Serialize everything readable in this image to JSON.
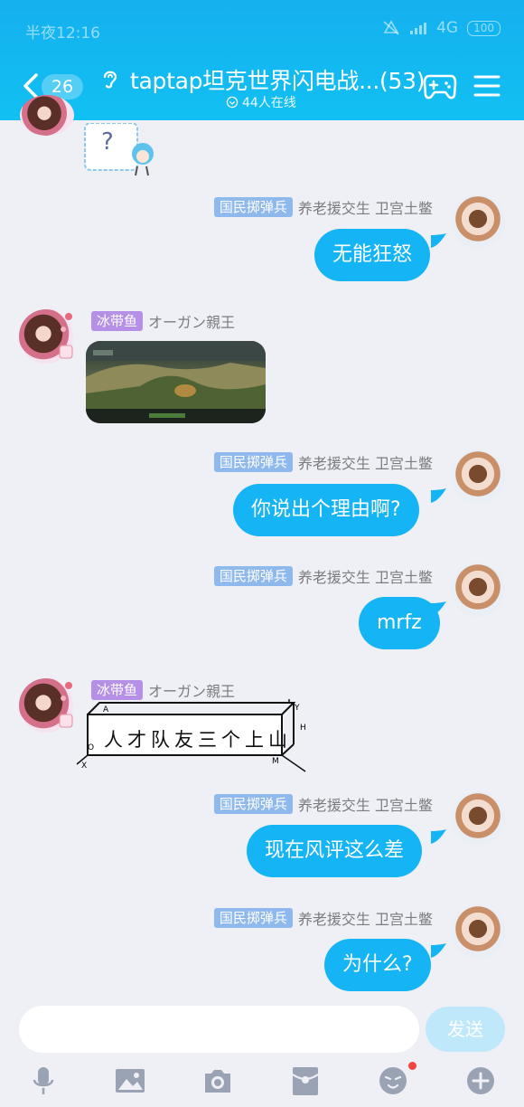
{
  "status_bar": {
    "time": "半夜12:16",
    "network": "4G",
    "battery": "100"
  },
  "header": {
    "unread_count": "26",
    "title": "taptap坦克世界闪电战...(53)",
    "online": "44人在线"
  },
  "messages": [
    {
      "side": "left",
      "type": "sticker",
      "content": "?"
    },
    {
      "side": "right",
      "tag": "国民掷弹兵",
      "sender": "养老援交生 卫宫土鳖",
      "text": "无能狂怒"
    },
    {
      "side": "left",
      "tag": "冰带鱼",
      "sender": "オーガン親王",
      "type": "image"
    },
    {
      "side": "right",
      "tag": "国民掷弹兵",
      "sender": "养老援交生 卫宫土鳖",
      "text": "你说出个理由啊?"
    },
    {
      "side": "right",
      "tag": "国民掷弹兵",
      "sender": "养老援交生 卫宫土鳖",
      "text": "mrfz"
    },
    {
      "side": "left",
      "tag": "冰带鱼",
      "sender": "オーガン親王",
      "type": "sticker",
      "sticker_text": "人才队友三个上山",
      "axis_labels": {
        "a": "A",
        "y": "Y",
        "h": "H",
        "o": "O",
        "x": "X",
        "m": "M"
      }
    },
    {
      "side": "right",
      "tag": "国民掷弹兵",
      "sender": "养老援交生 卫宫土鳖",
      "text": "现在风评这么差"
    },
    {
      "side": "right",
      "tag": "国民掷弹兵",
      "sender": "养老援交生 卫宫土鳖",
      "text": "为什么?"
    }
  ],
  "input": {
    "value": "",
    "send_label": "发送"
  },
  "toolbar": [
    "microphone-icon",
    "image-icon",
    "camera-icon",
    "red-packet-icon",
    "emoji-icon",
    "plus-icon"
  ],
  "colors": {
    "header": "#15b0ef",
    "bubble": "#14b4f5",
    "tag_blue": "#8fb8ec",
    "tag_purple": "#b590e6",
    "background": "#eef0f6",
    "send_button": "#bfe8fb",
    "notification_dot": "#f2463e"
  }
}
